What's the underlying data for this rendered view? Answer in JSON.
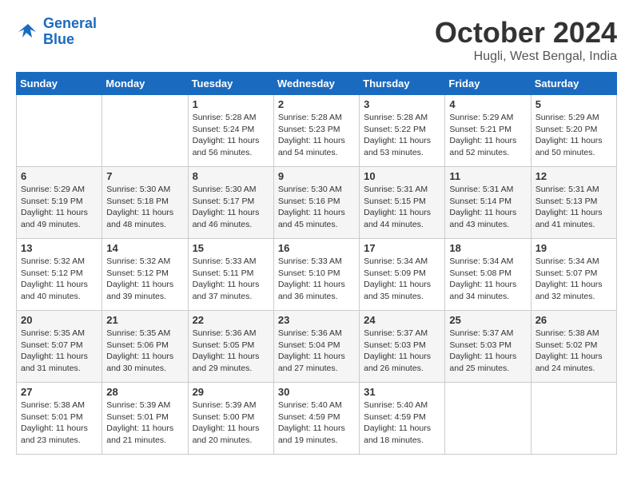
{
  "logo": {
    "line1": "General",
    "line2": "Blue"
  },
  "title": "October 2024",
  "location": "Hugli, West Bengal, India",
  "days_of_week": [
    "Sunday",
    "Monday",
    "Tuesday",
    "Wednesday",
    "Thursday",
    "Friday",
    "Saturday"
  ],
  "weeks": [
    [
      {
        "day": "",
        "sunrise": "",
        "sunset": "",
        "daylight": ""
      },
      {
        "day": "",
        "sunrise": "",
        "sunset": "",
        "daylight": ""
      },
      {
        "day": "1",
        "sunrise": "Sunrise: 5:28 AM",
        "sunset": "Sunset: 5:24 PM",
        "daylight": "Daylight: 11 hours and 56 minutes."
      },
      {
        "day": "2",
        "sunrise": "Sunrise: 5:28 AM",
        "sunset": "Sunset: 5:23 PM",
        "daylight": "Daylight: 11 hours and 54 minutes."
      },
      {
        "day": "3",
        "sunrise": "Sunrise: 5:28 AM",
        "sunset": "Sunset: 5:22 PM",
        "daylight": "Daylight: 11 hours and 53 minutes."
      },
      {
        "day": "4",
        "sunrise": "Sunrise: 5:29 AM",
        "sunset": "Sunset: 5:21 PM",
        "daylight": "Daylight: 11 hours and 52 minutes."
      },
      {
        "day": "5",
        "sunrise": "Sunrise: 5:29 AM",
        "sunset": "Sunset: 5:20 PM",
        "daylight": "Daylight: 11 hours and 50 minutes."
      }
    ],
    [
      {
        "day": "6",
        "sunrise": "Sunrise: 5:29 AM",
        "sunset": "Sunset: 5:19 PM",
        "daylight": "Daylight: 11 hours and 49 minutes."
      },
      {
        "day": "7",
        "sunrise": "Sunrise: 5:30 AM",
        "sunset": "Sunset: 5:18 PM",
        "daylight": "Daylight: 11 hours and 48 minutes."
      },
      {
        "day": "8",
        "sunrise": "Sunrise: 5:30 AM",
        "sunset": "Sunset: 5:17 PM",
        "daylight": "Daylight: 11 hours and 46 minutes."
      },
      {
        "day": "9",
        "sunrise": "Sunrise: 5:30 AM",
        "sunset": "Sunset: 5:16 PM",
        "daylight": "Daylight: 11 hours and 45 minutes."
      },
      {
        "day": "10",
        "sunrise": "Sunrise: 5:31 AM",
        "sunset": "Sunset: 5:15 PM",
        "daylight": "Daylight: 11 hours and 44 minutes."
      },
      {
        "day": "11",
        "sunrise": "Sunrise: 5:31 AM",
        "sunset": "Sunset: 5:14 PM",
        "daylight": "Daylight: 11 hours and 43 minutes."
      },
      {
        "day": "12",
        "sunrise": "Sunrise: 5:31 AM",
        "sunset": "Sunset: 5:13 PM",
        "daylight": "Daylight: 11 hours and 41 minutes."
      }
    ],
    [
      {
        "day": "13",
        "sunrise": "Sunrise: 5:32 AM",
        "sunset": "Sunset: 5:12 PM",
        "daylight": "Daylight: 11 hours and 40 minutes."
      },
      {
        "day": "14",
        "sunrise": "Sunrise: 5:32 AM",
        "sunset": "Sunset: 5:12 PM",
        "daylight": "Daylight: 11 hours and 39 minutes."
      },
      {
        "day": "15",
        "sunrise": "Sunrise: 5:33 AM",
        "sunset": "Sunset: 5:11 PM",
        "daylight": "Daylight: 11 hours and 37 minutes."
      },
      {
        "day": "16",
        "sunrise": "Sunrise: 5:33 AM",
        "sunset": "Sunset: 5:10 PM",
        "daylight": "Daylight: 11 hours and 36 minutes."
      },
      {
        "day": "17",
        "sunrise": "Sunrise: 5:34 AM",
        "sunset": "Sunset: 5:09 PM",
        "daylight": "Daylight: 11 hours and 35 minutes."
      },
      {
        "day": "18",
        "sunrise": "Sunrise: 5:34 AM",
        "sunset": "Sunset: 5:08 PM",
        "daylight": "Daylight: 11 hours and 34 minutes."
      },
      {
        "day": "19",
        "sunrise": "Sunrise: 5:34 AM",
        "sunset": "Sunset: 5:07 PM",
        "daylight": "Daylight: 11 hours and 32 minutes."
      }
    ],
    [
      {
        "day": "20",
        "sunrise": "Sunrise: 5:35 AM",
        "sunset": "Sunset: 5:07 PM",
        "daylight": "Daylight: 11 hours and 31 minutes."
      },
      {
        "day": "21",
        "sunrise": "Sunrise: 5:35 AM",
        "sunset": "Sunset: 5:06 PM",
        "daylight": "Daylight: 11 hours and 30 minutes."
      },
      {
        "day": "22",
        "sunrise": "Sunrise: 5:36 AM",
        "sunset": "Sunset: 5:05 PM",
        "daylight": "Daylight: 11 hours and 29 minutes."
      },
      {
        "day": "23",
        "sunrise": "Sunrise: 5:36 AM",
        "sunset": "Sunset: 5:04 PM",
        "daylight": "Daylight: 11 hours and 27 minutes."
      },
      {
        "day": "24",
        "sunrise": "Sunrise: 5:37 AM",
        "sunset": "Sunset: 5:03 PM",
        "daylight": "Daylight: 11 hours and 26 minutes."
      },
      {
        "day": "25",
        "sunrise": "Sunrise: 5:37 AM",
        "sunset": "Sunset: 5:03 PM",
        "daylight": "Daylight: 11 hours and 25 minutes."
      },
      {
        "day": "26",
        "sunrise": "Sunrise: 5:38 AM",
        "sunset": "Sunset: 5:02 PM",
        "daylight": "Daylight: 11 hours and 24 minutes."
      }
    ],
    [
      {
        "day": "27",
        "sunrise": "Sunrise: 5:38 AM",
        "sunset": "Sunset: 5:01 PM",
        "daylight": "Daylight: 11 hours and 23 minutes."
      },
      {
        "day": "28",
        "sunrise": "Sunrise: 5:39 AM",
        "sunset": "Sunset: 5:01 PM",
        "daylight": "Daylight: 11 hours and 21 minutes."
      },
      {
        "day": "29",
        "sunrise": "Sunrise: 5:39 AM",
        "sunset": "Sunset: 5:00 PM",
        "daylight": "Daylight: 11 hours and 20 minutes."
      },
      {
        "day": "30",
        "sunrise": "Sunrise: 5:40 AM",
        "sunset": "Sunset: 4:59 PM",
        "daylight": "Daylight: 11 hours and 19 minutes."
      },
      {
        "day": "31",
        "sunrise": "Sunrise: 5:40 AM",
        "sunset": "Sunset: 4:59 PM",
        "daylight": "Daylight: 11 hours and 18 minutes."
      },
      {
        "day": "",
        "sunrise": "",
        "sunset": "",
        "daylight": ""
      },
      {
        "day": "",
        "sunrise": "",
        "sunset": "",
        "daylight": ""
      }
    ]
  ]
}
